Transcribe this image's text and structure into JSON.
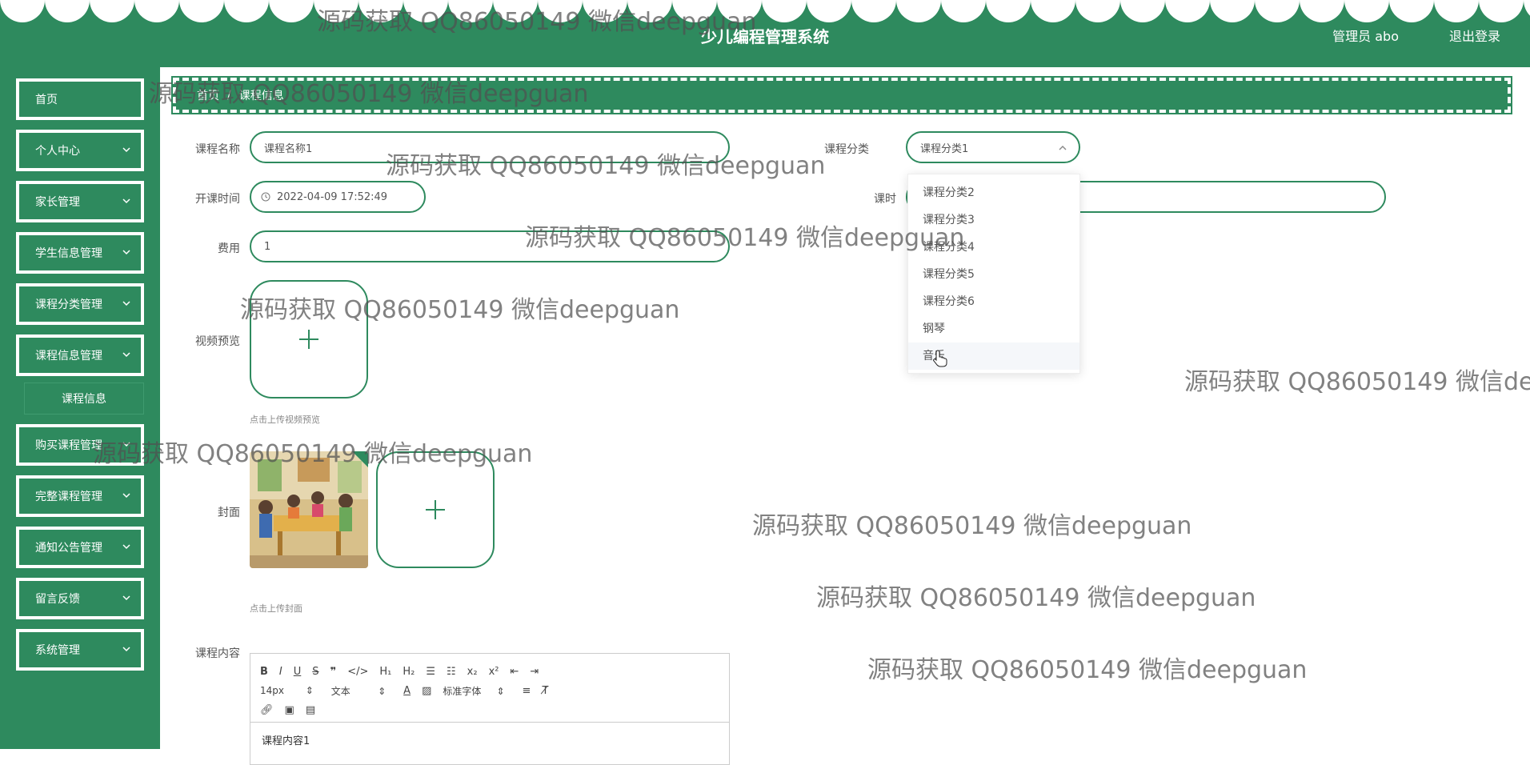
{
  "header": {
    "title": "少儿编程管理系统",
    "user": "管理员 abo",
    "logout": "退出登录"
  },
  "sidebar": {
    "items": [
      {
        "label": "首页",
        "chevron": false
      },
      {
        "label": "个人中心",
        "chevron": true
      },
      {
        "label": "家长管理",
        "chevron": true
      },
      {
        "label": "学生信息管理",
        "chevron": true
      },
      {
        "label": "课程分类管理",
        "chevron": true
      },
      {
        "label": "课程信息管理",
        "chevron": true
      },
      {
        "label": "购买课程管理",
        "chevron": true
      },
      {
        "label": "完整课程管理",
        "chevron": true
      },
      {
        "label": "通知公告管理",
        "chevron": true
      },
      {
        "label": "留言反馈",
        "chevron": true
      },
      {
        "label": "系统管理",
        "chevron": true
      }
    ],
    "subitem": "课程信息"
  },
  "breadcrumb": {
    "home": "首页",
    "separator": "/",
    "current": "课程信息"
  },
  "form": {
    "course_name": {
      "label": "课程名称",
      "value": "课程名称1"
    },
    "category": {
      "label": "课程分类",
      "value": "课程分类1"
    },
    "start_time": {
      "label": "开课时间",
      "value": "2022-04-09 17:52:49"
    },
    "hours": {
      "label": "课时",
      "value": ""
    },
    "fee": {
      "label": "费用",
      "value": "1"
    },
    "video": {
      "label": "视频预览",
      "hint": "点击上传视频预览"
    },
    "cover": {
      "label": "封面",
      "hint": "点击上传封面"
    },
    "content": {
      "label": "课程内容",
      "value": "课程内容1"
    }
  },
  "dropdown": {
    "options": [
      "课程分类2",
      "课程分类3",
      "课程分类4",
      "课程分类5",
      "课程分类6",
      "钢琴",
      "音乐"
    ],
    "hovered_index": 6
  },
  "editor": {
    "font_size": "14px",
    "block": "文本",
    "font_family": "标准字体"
  },
  "watermark": "源码获取 QQ86050149 微信deepguan",
  "colors": {
    "primary": "#2e8a5e"
  }
}
